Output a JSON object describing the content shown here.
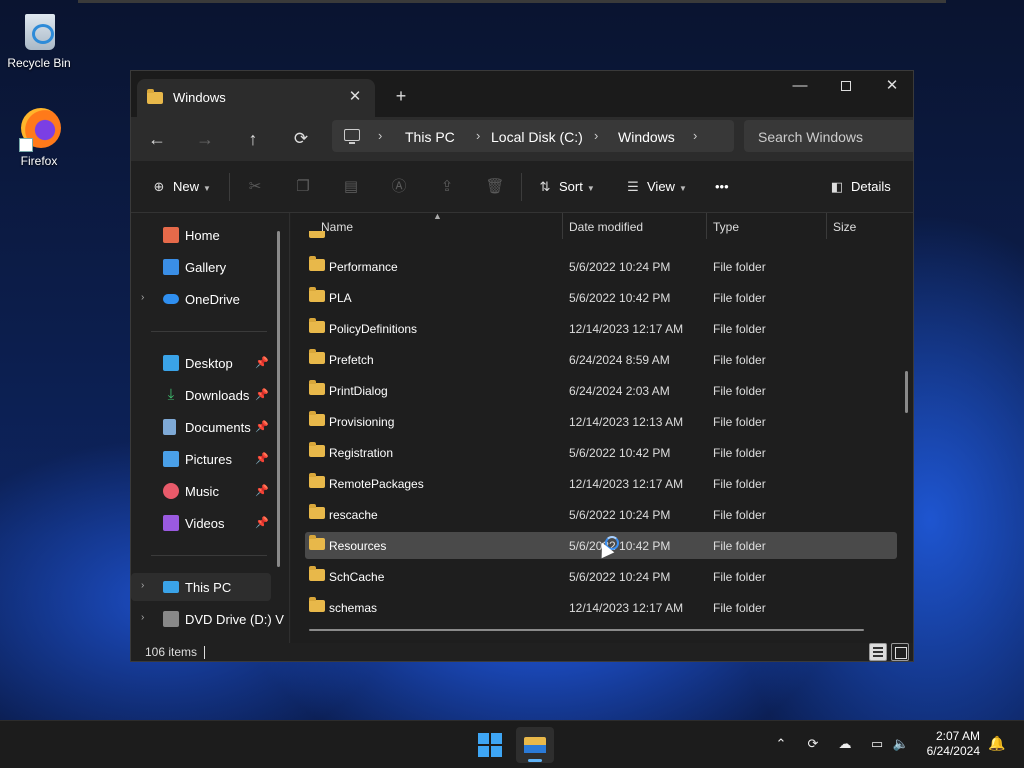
{
  "desktop": {
    "icons": [
      {
        "label": "Recycle Bin"
      },
      {
        "label": "Firefox"
      }
    ]
  },
  "window": {
    "tab_title": "Windows",
    "tab_close": "✕",
    "new_tab": "+",
    "controls": {
      "minimize": "—",
      "close": "✕"
    },
    "nav": {
      "back": "←",
      "forward": "→",
      "up": "↑",
      "refresh": "⟳"
    },
    "breadcrumb": [
      "This PC",
      "Local Disk (C:)",
      "Windows"
    ],
    "breadcrumb_sep": "›",
    "search_placeholder": "Search Windows",
    "toolbar": {
      "new_label": "New",
      "sort_label": "Sort",
      "view_label": "View",
      "more_label": "•••",
      "details_label": "Details"
    },
    "sidebar": {
      "items": [
        {
          "label": "Home",
          "icon": "home-icon"
        },
        {
          "label": "Gallery",
          "icon": "gallery-icon"
        },
        {
          "label": "OneDrive",
          "icon": "cloud-icon"
        },
        {
          "label": "Desktop",
          "icon": "desktop-icon"
        },
        {
          "label": "Downloads",
          "icon": "download-icon"
        },
        {
          "label": "Documents",
          "icon": "documents-icon"
        },
        {
          "label": "Pictures",
          "icon": "pictures-icon"
        },
        {
          "label": "Music",
          "icon": "music-icon"
        },
        {
          "label": "Videos",
          "icon": "videos-icon"
        },
        {
          "label": "This PC",
          "icon": "computer-icon"
        },
        {
          "label": "DVD Drive (D:) V",
          "icon": "dvd-drive-icon"
        }
      ]
    },
    "columns": {
      "name": "Name",
      "date": "Date modified",
      "type": "Type",
      "size": "Size"
    },
    "files": [
      {
        "name": "Performance",
        "date": "5/6/2022 10:24 PM",
        "type": "File folder"
      },
      {
        "name": "PLA",
        "date": "5/6/2022 10:42 PM",
        "type": "File folder"
      },
      {
        "name": "PolicyDefinitions",
        "date": "12/14/2023 12:17 AM",
        "type": "File folder"
      },
      {
        "name": "Prefetch",
        "date": "6/24/2024 8:59 AM",
        "type": "File folder"
      },
      {
        "name": "PrintDialog",
        "date": "6/24/2024 2:03 AM",
        "type": "File folder"
      },
      {
        "name": "Provisioning",
        "date": "12/14/2023 12:13 AM",
        "type": "File folder"
      },
      {
        "name": "Registration",
        "date": "5/6/2022 10:42 PM",
        "type": "File folder"
      },
      {
        "name": "RemotePackages",
        "date": "12/14/2023 12:17 AM",
        "type": "File folder"
      },
      {
        "name": "rescache",
        "date": "5/6/2022 10:24 PM",
        "type": "File folder"
      },
      {
        "name": "Resources",
        "date": "5/6/2022 10:42 PM",
        "type": "File folder"
      },
      {
        "name": "SchCache",
        "date": "5/6/2022 10:24 PM",
        "type": "File folder"
      },
      {
        "name": "schemas",
        "date": "12/14/2023 12:17 AM",
        "type": "File folder"
      }
    ],
    "status": {
      "item_count": "106 items"
    }
  },
  "taskbar": {
    "clock_time": "2:07 AM",
    "clock_date": "6/24/2024"
  }
}
